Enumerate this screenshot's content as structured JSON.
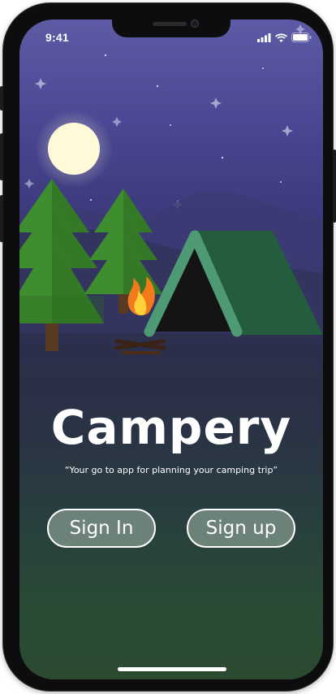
{
  "status_bar": {
    "time": "9:41"
  },
  "app": {
    "title": "Campery",
    "tagline": "“Your go to app for planning your camping trip”"
  },
  "buttons": {
    "sign_in": "Sign In",
    "sign_up": "Sign up"
  },
  "icons": [
    "cellular-signal-icon",
    "wifi-icon",
    "battery-icon",
    "campfire-icon",
    "moon-icon",
    "tent-icon",
    "pine-tree-icon",
    "star-icon"
  ],
  "colors": {
    "sky_top": "#5d5aa6",
    "ground_bottom": "#2b4a30",
    "moon": "#fff9d8",
    "tent": "#245c3e",
    "tent_frame": "#4e9a75",
    "tree": "#3d8a2c"
  }
}
